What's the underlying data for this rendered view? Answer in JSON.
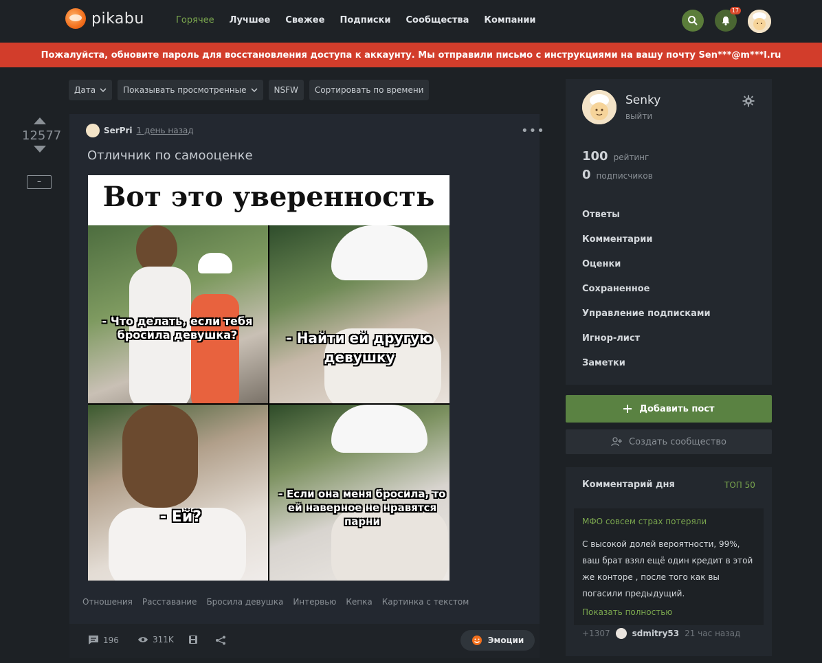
{
  "header": {
    "logo_text": "pikabu",
    "nav": [
      "Горячее",
      "Лучшее",
      "Свежее",
      "Подписки",
      "Сообщества",
      "Компании"
    ],
    "notifications_count": "17"
  },
  "banner": {
    "text": "Пожалуйста, обновите пароль для восстановления доступа к аккаунту. Мы отправили письмо с инструкциями на вашу почту Sen***@m***l.ru"
  },
  "filters": {
    "date": "Дата",
    "show_viewed": "Показывать просмотренные",
    "nsfw": "NSFW",
    "sort": "Сортировать по времени"
  },
  "post": {
    "rating": "12577",
    "minus": "–",
    "author": "SerPri",
    "time": "1 день назад",
    "title": "Отличник по самооценке",
    "meme": {
      "header": "Вот это уверенность",
      "cap1": "- Что делать, если тебя бросила девушка?",
      "cap2": "- Найти ей другую девушку",
      "cap3": "- Ей?",
      "cap4": "- Если она меня бросила, то ей наверное не нравятся парни"
    },
    "tags": [
      "Отношения",
      "Расставание",
      "Бросила девушка",
      "Интервью",
      "Кепка",
      "Картинка с текстом"
    ],
    "comments": "196",
    "views": "311K",
    "emotion_label": "Эмоции"
  },
  "profile": {
    "name": "Senky",
    "logout": "выйти",
    "rating_value": "100",
    "rating_label": "рейтинг",
    "subscribers_value": "0",
    "subscribers_label": "подписчиков",
    "menu": [
      "Ответы",
      "Комментарии",
      "Оценки",
      "Сохраненное",
      "Управление подписками",
      "Игнор-лист",
      "Заметки"
    ]
  },
  "actions": {
    "add_post": "Добавить пост",
    "create_community": "Создать сообщество"
  },
  "comment_of_day": {
    "title": "Комментарий дня",
    "top_link": "ТОП 50",
    "post_link": "МФО совсем страх потеряли",
    "text": "С высокой долей вероятности, 99%, ваш брат взял ещё один кредит в этой же конторе , после того как вы погасили предыдущий.",
    "show_more": "Показать полностью",
    "rating": "+1307",
    "author": "sdmitry53",
    "time": "21 час назад"
  },
  "colors": {
    "accent_green": "#7aa64e",
    "banner_red": "#d23d2b",
    "background": "#1d2125"
  }
}
